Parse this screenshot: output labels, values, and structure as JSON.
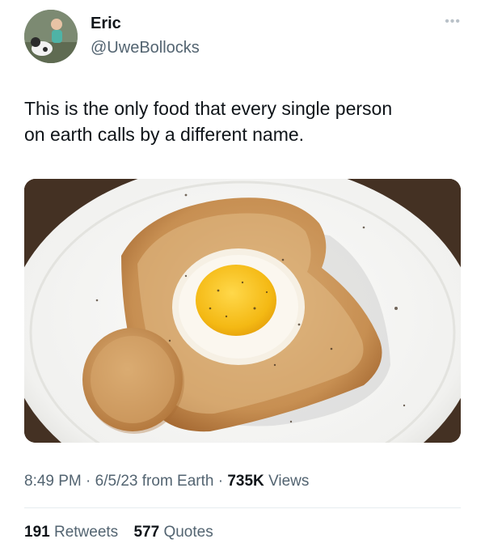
{
  "author": {
    "name": "Eric",
    "handle": "@UweBollocks",
    "more_icon": "ellipsis-icon"
  },
  "tweet": {
    "text_lines": [
      "This is the only food that every single person",
      "on earth calls by a different name."
    ]
  },
  "meta": {
    "time": "8:49 PM",
    "separator": "·",
    "date": "6/5/23",
    "source": "from Earth",
    "views_count": "735K",
    "views_label": "Views"
  },
  "stats": {
    "retweets_count": "191",
    "retweets_label": "Retweets",
    "quotes_count": "577",
    "quotes_label": "Quotes"
  }
}
